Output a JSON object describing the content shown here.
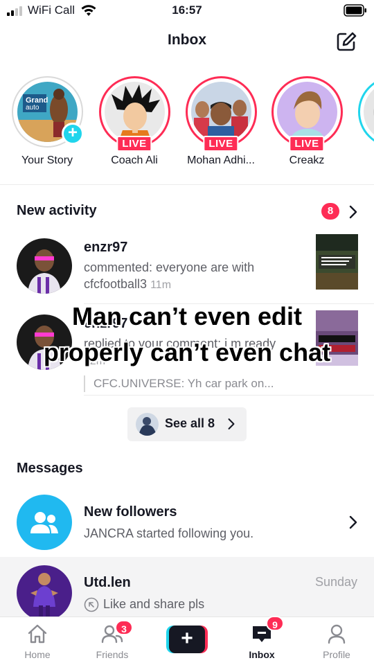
{
  "status_bar": {
    "carrier": "WiFi Call",
    "time": "16:57"
  },
  "header": {
    "title": "Inbox"
  },
  "stories": [
    {
      "name": "Your Story",
      "badge": "+",
      "avatar_icon": "own-story-avatar"
    },
    {
      "name": "Coach Ali",
      "badge": "LIVE",
      "avatar_icon": "anime-avatar"
    },
    {
      "name": "Mohan Adhi...",
      "badge": "LIVE",
      "avatar_icon": "person-avatar"
    },
    {
      "name": "Creakz",
      "badge": "LIVE",
      "avatar_icon": "person-avatar"
    }
  ],
  "activity": {
    "title": "New activity",
    "count": "8",
    "items": [
      {
        "user": "enzr97",
        "text": "commented: everyone are with cfcfootball3",
        "time": "11m"
      },
      {
        "user": "enzr97",
        "text": "replied to your comment: i m ready",
        "time": "32m",
        "quote": "CFC.UNIVERSE: Yh car park on..."
      }
    ],
    "see_all": "See all 8"
  },
  "overlay_caption": {
    "line1": "Man can’t even edit",
    "line2": "properly can’t even chat"
  },
  "messages": {
    "title": "Messages",
    "items": [
      {
        "name": "New followers",
        "sub": "JANCRA started following you.",
        "day": ""
      },
      {
        "name": "Utd.len",
        "sub": "Like and share pls",
        "day": "Sunday"
      }
    ]
  },
  "tabbar": {
    "items": [
      {
        "label": "Home",
        "badge": ""
      },
      {
        "label": "Friends",
        "badge": "3"
      },
      {
        "label": "",
        "badge": ""
      },
      {
        "label": "Inbox",
        "badge": "9"
      },
      {
        "label": "Profile",
        "badge": ""
      }
    ]
  },
  "colors": {
    "accent_pink": "#fe2c55",
    "accent_cyan": "#20d5ec",
    "text": "#161823"
  }
}
